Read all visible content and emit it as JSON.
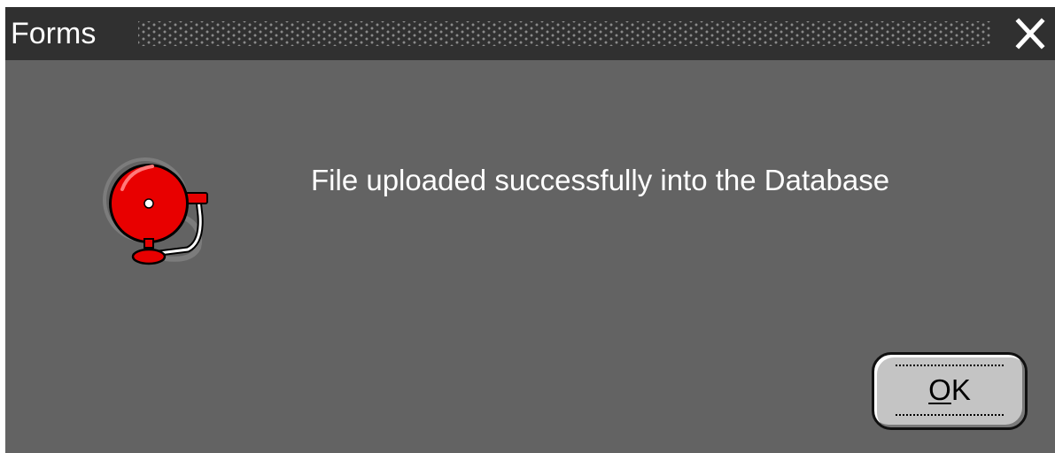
{
  "window": {
    "title": "Forms",
    "close_icon": "close-icon"
  },
  "dialog": {
    "icon": "alarm-bell-icon",
    "message": "File uploaded successfully into the Database"
  },
  "buttons": {
    "ok": {
      "label_mnemonic": "O",
      "label_rest": "K"
    }
  },
  "colors": {
    "titlebar": "#303030",
    "dialog_background": "#636363",
    "text": "#ffffff",
    "button_face": "#c4c4c4",
    "bell_red": "#e80000"
  }
}
